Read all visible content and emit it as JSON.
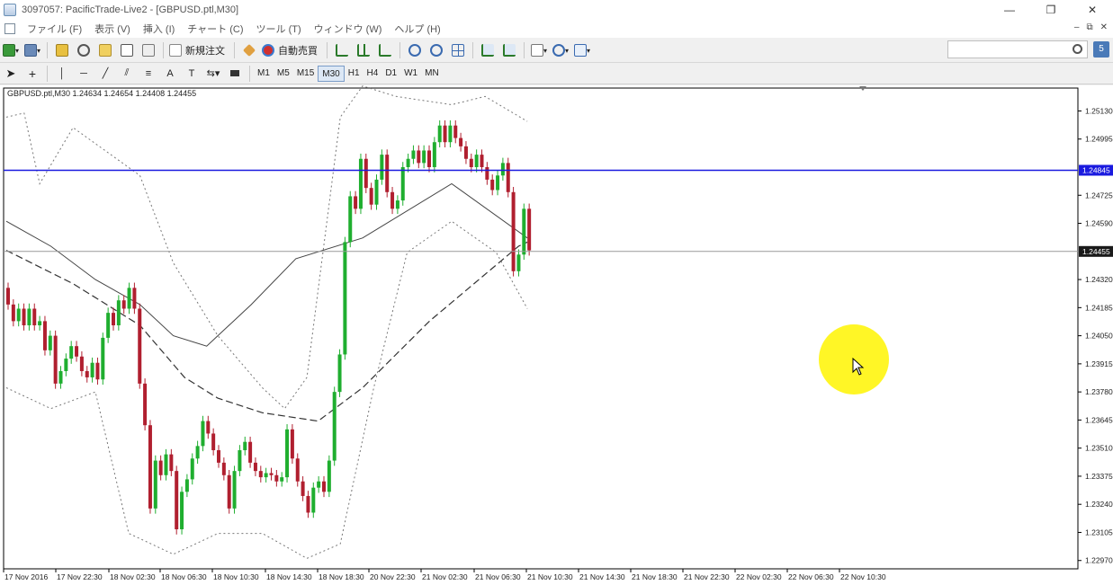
{
  "window": {
    "title": "3097057: PacificTrade-Live2 - [GBPUSD.ptl,M30]",
    "minimize": "—",
    "restore": "❐",
    "close": "✕"
  },
  "menu": {
    "items": [
      "ファイル (F)",
      "表示 (V)",
      "挿入 (I)",
      "チャート (C)",
      "ツール (T)",
      "ウィンドウ (W)",
      "ヘルプ (H)"
    ],
    "mdi_minimize": "‒",
    "mdi_restore": "⧉",
    "mdi_close": "✕"
  },
  "toolbar": {
    "new_order": "新規注文",
    "auto_trading": "自動売買",
    "help_label": "5"
  },
  "timeframes": [
    "M1",
    "M5",
    "M15",
    "M30",
    "H1",
    "H4",
    "D1",
    "W1",
    "MN"
  ],
  "active_timeframe": "M30",
  "search": {
    "placeholder": ""
  },
  "chart": {
    "header": "GBPUSD.ptl,M30  1.24634 1.24654 1.24408 1.24455",
    "colors": {
      "bull": "#1fae2f",
      "bear": "#b01f2f",
      "hline": "#1a1adf",
      "price_label_bg": "#1a1a1a",
      "hline_label_bg": "#1a1adf",
      "highlight": "#fff500"
    }
  },
  "chart_data": {
    "type": "candlestick",
    "symbol": "GBPUSD.ptl",
    "timeframe": "M30",
    "ohlc_header": {
      "open": 1.24634,
      "high": 1.24654,
      "low": 1.24408,
      "close": 1.24455
    },
    "y_ticks": [
      "1.25130",
      "1.24995",
      "1.24725",
      "1.24590",
      "1.24320",
      "1.24185",
      "1.24050",
      "1.23915",
      "1.23780",
      "1.23645",
      "1.23510",
      "1.23375",
      "1.23240",
      "1.23105",
      "1.22970"
    ],
    "ylim": [
      1.2293,
      1.2524
    ],
    "x_ticks": [
      "17 Nov 2016",
      "17 Nov 22:30",
      "18 Nov 02:30",
      "18 Nov 06:30",
      "18 Nov 10:30",
      "18 Nov 14:30",
      "18 Nov 18:30",
      "20 Nov 22:30",
      "21 Nov 02:30",
      "21 Nov 06:30",
      "21 Nov 10:30",
      "21 Nov 14:30",
      "21 Nov 18:30",
      "21 Nov 22:30",
      "22 Nov 02:30",
      "22 Nov 06:30",
      "22 Nov 10:30"
    ],
    "horizontal_line": {
      "value": "1.24845"
    },
    "current_price": {
      "value": "1.24455"
    },
    "candles": [
      [
        1.2428,
        1.242
      ],
      [
        1.242,
        1.2412
      ],
      [
        1.2412,
        1.2418
      ],
      [
        1.2418,
        1.241
      ],
      [
        1.241,
        1.2418
      ],
      [
        1.2418,
        1.241
      ],
      [
        1.241,
        1.2412
      ],
      [
        1.2412,
        1.2398
      ],
      [
        1.2398,
        1.2405
      ],
      [
        1.2405,
        1.2382
      ],
      [
        1.2382,
        1.2388
      ],
      [
        1.2388,
        1.2394
      ],
      [
        1.2394,
        1.24
      ],
      [
        1.24,
        1.2395
      ],
      [
        1.2395,
        1.2388
      ],
      [
        1.2388,
        1.2385
      ],
      [
        1.2385,
        1.2392
      ],
      [
        1.2392,
        1.2384
      ],
      [
        1.2384,
        1.2404
      ],
      [
        1.2404,
        1.2416
      ],
      [
        1.2416,
        1.241
      ],
      [
        1.241,
        1.2422
      ],
      [
        1.2422,
        1.2418
      ],
      [
        1.2418,
        1.2428
      ],
      [
        1.2428,
        1.2418
      ],
      [
        1.2418,
        1.2382
      ],
      [
        1.2382,
        1.2362
      ],
      [
        1.2362,
        1.2322
      ],
      [
        1.2322,
        1.2345
      ],
      [
        1.2345,
        1.2338
      ],
      [
        1.2338,
        1.2348
      ],
      [
        1.2348,
        1.234
      ],
      [
        1.234,
        1.2312
      ],
      [
        1.2312,
        1.233
      ],
      [
        1.233,
        1.2336
      ],
      [
        1.2336,
        1.2346
      ],
      [
        1.2346,
        1.2352
      ],
      [
        1.2352,
        1.2364
      ],
      [
        1.2364,
        1.2358
      ],
      [
        1.2358,
        1.235
      ],
      [
        1.235,
        1.2344
      ],
      [
        1.2344,
        1.2338
      ],
      [
        1.2338,
        1.2322
      ],
      [
        1.2322,
        1.234
      ],
      [
        1.234,
        1.235
      ],
      [
        1.235,
        1.2354
      ],
      [
        1.2354,
        1.2344
      ],
      [
        1.2344,
        1.234
      ],
      [
        1.234,
        1.2337
      ],
      [
        1.2337,
        1.2339
      ],
      [
        1.2339,
        1.2338
      ],
      [
        1.2338,
        1.2335
      ],
      [
        1.2335,
        1.2337
      ],
      [
        1.2337,
        1.236
      ],
      [
        1.236,
        1.2346
      ],
      [
        1.2346,
        1.2335
      ],
      [
        1.2335,
        1.2328
      ],
      [
        1.2328,
        1.232
      ],
      [
        1.232,
        1.2332
      ],
      [
        1.2332,
        1.2335
      ],
      [
        1.2335,
        1.233
      ],
      [
        1.233,
        1.2345
      ],
      [
        1.2345,
        1.2378
      ],
      [
        1.2378,
        1.2396
      ],
      [
        1.2396,
        1.245
      ],
      [
        1.245,
        1.2472
      ],
      [
        1.2472,
        1.2466
      ],
      [
        1.2466,
        1.249
      ],
      [
        1.249,
        1.2476
      ],
      [
        1.2476,
        1.2468
      ],
      [
        1.2468,
        1.248
      ],
      [
        1.248,
        1.2492
      ],
      [
        1.2492,
        1.2474
      ],
      [
        1.2474,
        1.2466
      ],
      [
        1.2466,
        1.247
      ],
      [
        1.247,
        1.2486
      ],
      [
        1.2486,
        1.249
      ],
      [
        1.249,
        1.2494
      ],
      [
        1.2494,
        1.2488
      ],
      [
        1.2488,
        1.2494
      ],
      [
        1.2494,
        1.2486
      ],
      [
        1.2486,
        1.2498
      ],
      [
        1.2498,
        1.2506
      ],
      [
        1.2506,
        1.2498
      ],
      [
        1.2498,
        1.2506
      ],
      [
        1.2506,
        1.25
      ],
      [
        1.25,
        1.2496
      ],
      [
        1.2496,
        1.249
      ],
      [
        1.249,
        1.2486
      ],
      [
        1.2486,
        1.2492
      ],
      [
        1.2492,
        1.2486
      ],
      [
        1.2486,
        1.248
      ],
      [
        1.248,
        1.2475
      ],
      [
        1.2475,
        1.2482
      ],
      [
        1.2482,
        1.2488
      ],
      [
        1.2488,
        1.2474
      ],
      [
        1.2474,
        1.2436
      ],
      [
        1.2436,
        1.2444
      ],
      [
        1.2444,
        1.2466
      ],
      [
        1.2466,
        1.2446
      ]
    ],
    "moving_averages": [
      {
        "style": "solid-dark",
        "points": [
          [
            0,
            1.246
          ],
          [
            20,
            1.2448
          ],
          [
            40,
            1.2432
          ],
          [
            60,
            1.242
          ],
          [
            75,
            1.2405
          ],
          [
            90,
            1.24
          ],
          [
            110,
            1.242
          ],
          [
            130,
            1.2442
          ],
          [
            160,
            1.2452
          ],
          [
            200,
            1.2478
          ],
          [
            234,
            1.2452
          ]
        ]
      },
      {
        "style": "dashed-dark",
        "points": [
          [
            0,
            1.2446
          ],
          [
            30,
            1.243
          ],
          [
            60,
            1.241
          ],
          [
            80,
            1.2385
          ],
          [
            95,
            1.2375
          ],
          [
            115,
            1.2368
          ],
          [
            140,
            1.2364
          ],
          [
            160,
            1.238
          ],
          [
            190,
            1.2412
          ],
          [
            230,
            1.2448
          ],
          [
            234,
            1.245
          ]
        ]
      }
    ],
    "bands": {
      "upper_outer": [
        [
          0,
          1.251
        ],
        [
          8,
          1.2512
        ],
        [
          15,
          1.2478
        ],
        [
          30,
          1.2505
        ],
        [
          60,
          1.2482
        ],
        [
          75,
          1.244
        ],
        [
          95,
          1.2405
        ],
        [
          115,
          1.238
        ],
        [
          125,
          1.237
        ],
        [
          135,
          1.2385
        ],
        [
          150,
          1.251
        ],
        [
          160,
          1.2525
        ],
        [
          175,
          1.252
        ],
        [
          200,
          1.2516
        ],
        [
          215,
          1.252
        ],
        [
          234,
          1.2508
        ]
      ],
      "lower_outer": [
        [
          0,
          1.238
        ],
        [
          20,
          1.237
        ],
        [
          40,
          1.2378
        ],
        [
          55,
          1.231
        ],
        [
          75,
          1.23
        ],
        [
          95,
          1.231
        ],
        [
          115,
          1.231
        ],
        [
          135,
          1.2298
        ],
        [
          150,
          1.2305
        ],
        [
          165,
          1.238
        ],
        [
          180,
          1.2445
        ],
        [
          200,
          1.246
        ],
        [
          220,
          1.2445
        ],
        [
          234,
          1.2418
        ]
      ]
    }
  }
}
